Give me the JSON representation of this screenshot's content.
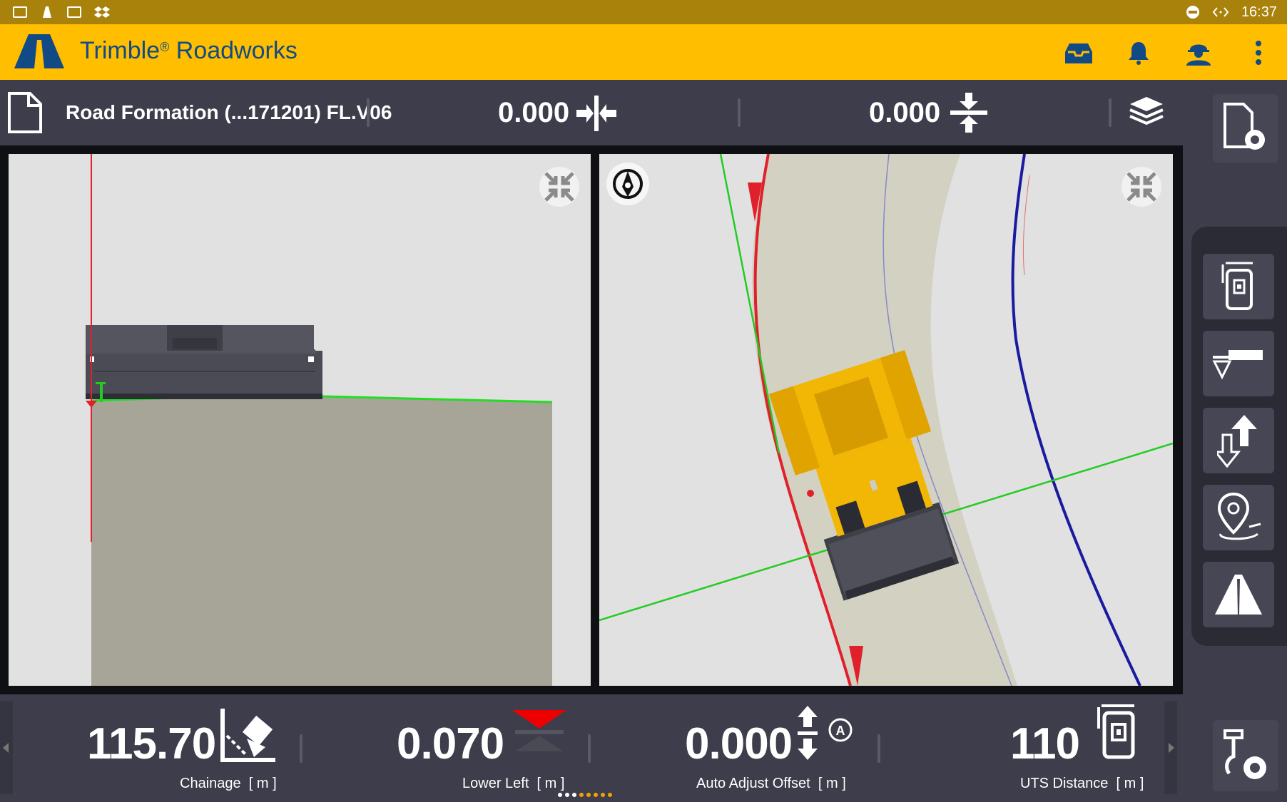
{
  "status_bar": {
    "time": "16:37",
    "icons": [
      "gallery-icon",
      "roadworks-icon",
      "wallet-icon",
      "dropbox-icon",
      "do-not-disturb-icon",
      "network-icon"
    ]
  },
  "app_bar": {
    "title": "Trimble",
    "title_mark": "®",
    "title_suffix": " Roadworks",
    "icons": [
      "inbox-icon",
      "bell-icon",
      "user-hardhat-icon",
      "more-vert-icon"
    ]
  },
  "toolbar": {
    "file_name": "Road Formation (...171201) FL.V06",
    "horizontal_offset": "0.000",
    "vertical_offset": "0.000"
  },
  "bottom_metrics": [
    {
      "value": "115.70",
      "label": "Chainage",
      "unit": "[ m ]"
    },
    {
      "value": "0.070",
      "label": "Lower Left",
      "unit": "[ m ]"
    },
    {
      "value": "0.000",
      "label": "Auto Adjust Offset",
      "unit": "[ m ]"
    },
    {
      "value": "110",
      "label": "UTS Distance",
      "unit": "[ m ]"
    }
  ],
  "colors": {
    "accent": "#ffbe00",
    "status_bar": "#a8820b",
    "brand_text": "#124a86",
    "background": "#3d3d4b",
    "design_line": "#22dd22",
    "alignment_line": "#e0202a",
    "string_line": "#1a1aa0",
    "machine": "#f2b705"
  },
  "page_indicator": {
    "count": 8,
    "active_from": 3
  }
}
